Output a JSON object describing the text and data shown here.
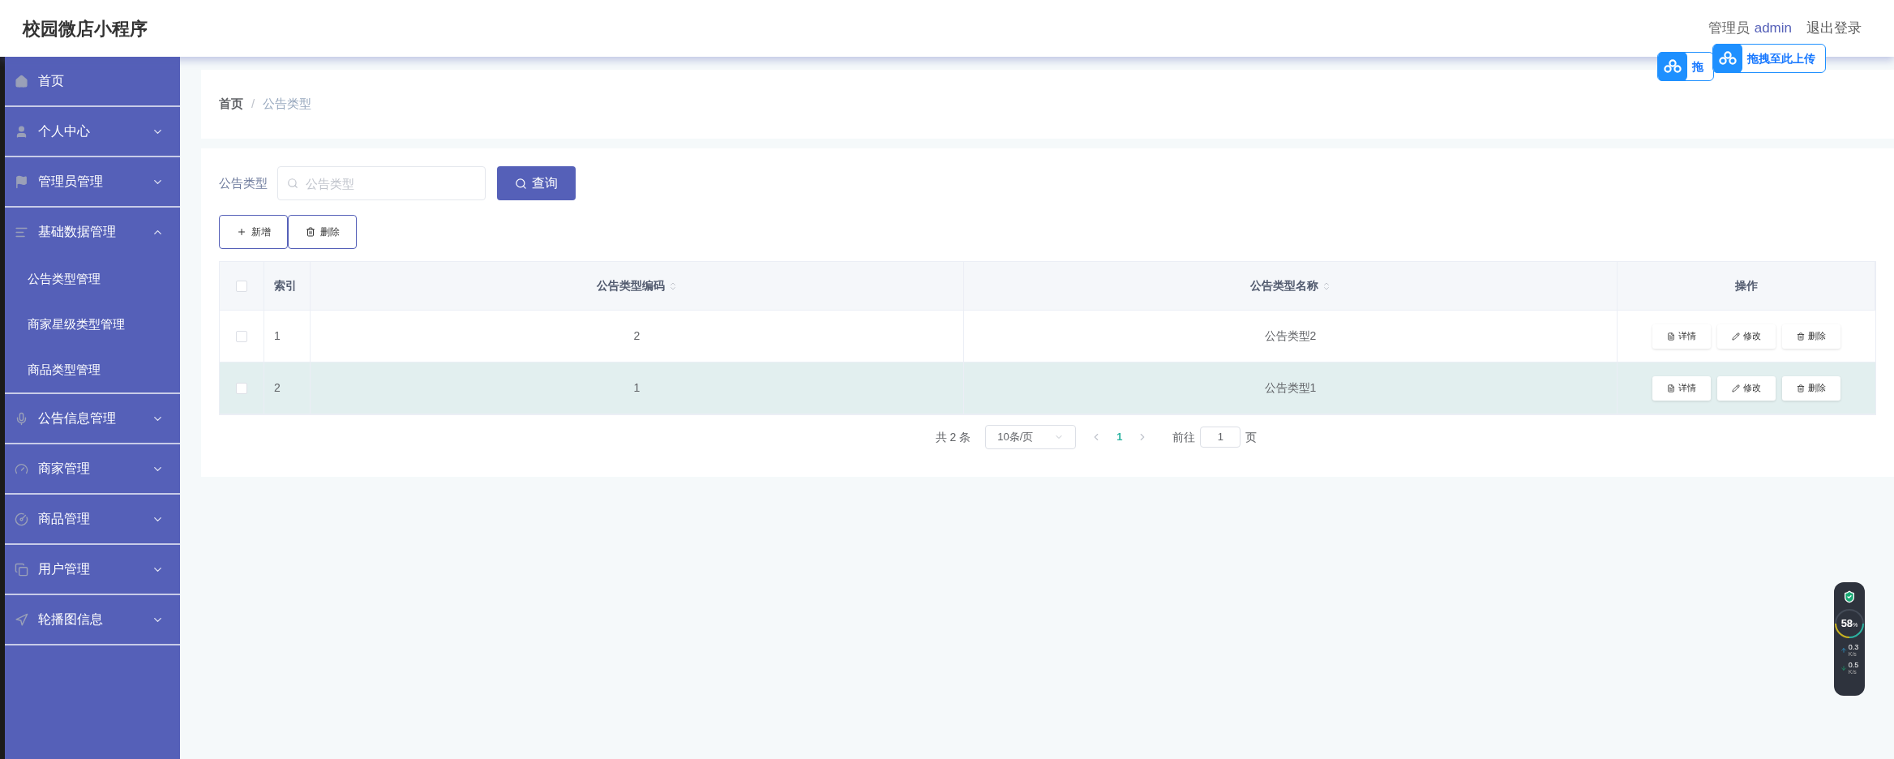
{
  "header": {
    "title": "校园微店小程序",
    "user_label": "管理员",
    "username": "admin",
    "logout": "退出登录"
  },
  "upload_overlays": [
    {
      "label": "拖"
    },
    {
      "label": "拖拽至此上传"
    }
  ],
  "sidebar": {
    "items": [
      {
        "label": "首页"
      },
      {
        "label": "个人中心",
        "expanded": false
      },
      {
        "label": "管理员管理",
        "expanded": false
      },
      {
        "label": "基础数据管理",
        "expanded": true,
        "children": [
          {
            "label": "公告类型管理"
          },
          {
            "label": "商家星级类型管理"
          },
          {
            "label": "商品类型管理"
          }
        ]
      },
      {
        "label": "公告信息管理",
        "expanded": false
      },
      {
        "label": "商家管理",
        "expanded": false
      },
      {
        "label": "商品管理",
        "expanded": false
      },
      {
        "label": "用户管理",
        "expanded": false
      },
      {
        "label": "轮播图信息",
        "expanded": false
      }
    ]
  },
  "breadcrumb": {
    "items": [
      "首页",
      "公告类型"
    ],
    "separator": "/"
  },
  "search": {
    "label": "公告类型",
    "placeholder": "公告类型",
    "button": "查询"
  },
  "actions": [
    {
      "kind": "add",
      "label": "新增"
    },
    {
      "kind": "delete",
      "label": "删除"
    }
  ],
  "table": {
    "select_all": {
      "checked": false
    },
    "columns": [
      {
        "label": "索引",
        "sortable": false
      },
      {
        "label": "公告类型编码",
        "sortable": true
      },
      {
        "label": "公告类型名称",
        "sortable": true
      },
      {
        "label": "操作",
        "sortable": false
      }
    ],
    "rows": [
      {
        "checked": false,
        "hovered": false,
        "cells": [
          "1",
          "2",
          "公告类型2"
        ],
        "actions": [
          {
            "kind": "detail",
            "label": "详情"
          },
          {
            "kind": "edit",
            "label": "修改"
          },
          {
            "kind": "delete",
            "label": "删除"
          }
        ]
      },
      {
        "checked": false,
        "hovered": true,
        "cells": [
          "2",
          "1",
          "公告类型1"
        ],
        "actions": [
          {
            "kind": "detail",
            "label": "详情"
          },
          {
            "kind": "edit",
            "label": "修改"
          },
          {
            "kind": "delete",
            "label": "删除"
          }
        ]
      }
    ]
  },
  "pagination": {
    "total": "共 2 条",
    "page_size": "10条/页",
    "pages": [
      {
        "label": "1",
        "selected": true
      }
    ],
    "goto_label": "前往",
    "goto_value": "1",
    "goto_suffix": "页"
  },
  "monitor": {
    "percent": "58",
    "percent_unit": "%",
    "upload": "0.3",
    "upload_unit": "K/s",
    "download": "0.5",
    "download_unit": "K/s"
  }
}
